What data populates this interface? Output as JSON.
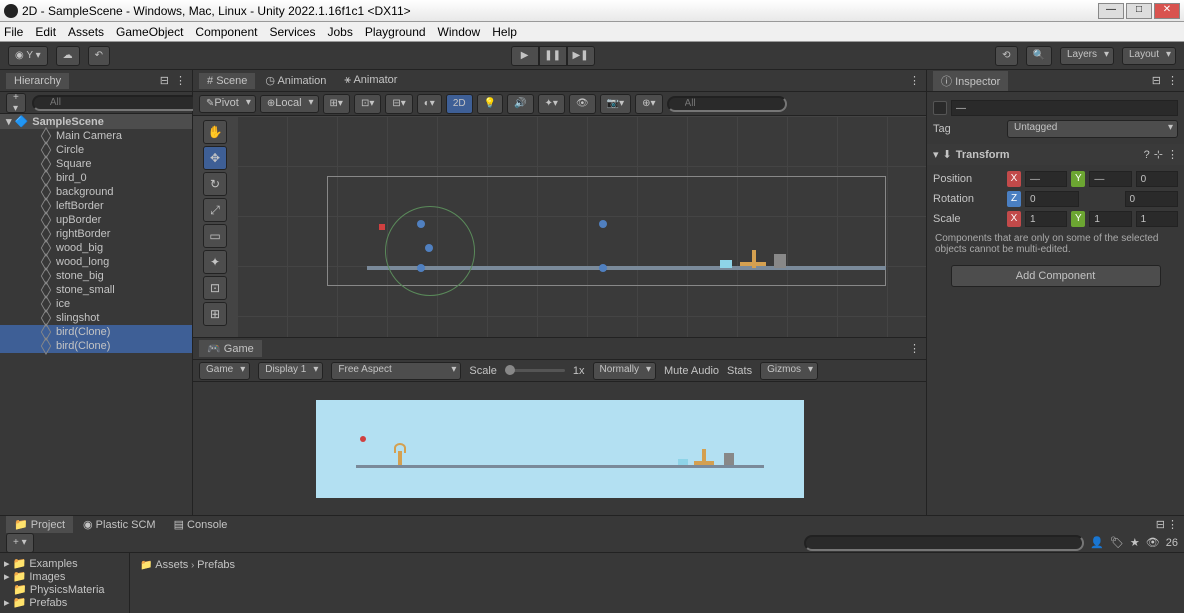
{
  "window": {
    "title": "2D - SampleScene - Windows, Mac, Linux - Unity 2022.1.16f1c1 <DX11>"
  },
  "menu": [
    "File",
    "Edit",
    "Assets",
    "GameObject",
    "Component",
    "Services",
    "Jobs",
    "Playground",
    "Window",
    "Help"
  ],
  "toolbar": {
    "account_icon": "☁",
    "layers": "Layers",
    "layout": "Layout"
  },
  "hierarchy": {
    "title": "Hierarchy",
    "search_placeholder": "All",
    "scene": "SampleScene",
    "items": [
      "Main Camera",
      "Circle",
      "Square",
      "bird_0",
      "background",
      "leftBorder",
      "upBorder",
      "rightBorder",
      "wood_big",
      "wood_long",
      "stone_big",
      "stone_small",
      "ice",
      "slingshot",
      "bird(Clone)",
      "bird(Clone)"
    ]
  },
  "scene": {
    "tabs": {
      "scene": "Scene",
      "animation": "Animation",
      "animator": "Animator"
    },
    "pivot": "Pivot",
    "local": "Local",
    "mode_2d": "2D",
    "search_placeholder": "All"
  },
  "game": {
    "tab": "Game",
    "mode": "Game",
    "display": "Display 1",
    "aspect": "Free Aspect",
    "scale_label": "Scale",
    "scale_value": "1x",
    "normally": "Normally",
    "mute": "Mute Audio",
    "stats": "Stats",
    "gizmos": "Gizmos"
  },
  "inspector": {
    "title": "Inspector",
    "tag_label": "Tag",
    "tag_value": "Untagged",
    "transform": "Transform",
    "position": "Position",
    "rotation": "Rotation",
    "scale": "Scale",
    "pos_x": "—",
    "pos_y": "—",
    "pos_z": "0",
    "rot_z": "0",
    "rot_extra": "0",
    "scale_x": "1",
    "scale_y": "1",
    "scale_z": "1",
    "warning": "Components that are only on some of the selected objects cannot be multi-edited.",
    "add_component": "Add Component"
  },
  "project": {
    "tabs": {
      "project": "Project",
      "plastic": "Plastic SCM",
      "console": "Console"
    },
    "tree": [
      "Examples",
      "Images",
      "PhysicsMateria",
      "Prefabs"
    ],
    "breadcrumb_assets": "Assets",
    "breadcrumb_prefabs": "Prefabs",
    "hidden_count": "26"
  }
}
